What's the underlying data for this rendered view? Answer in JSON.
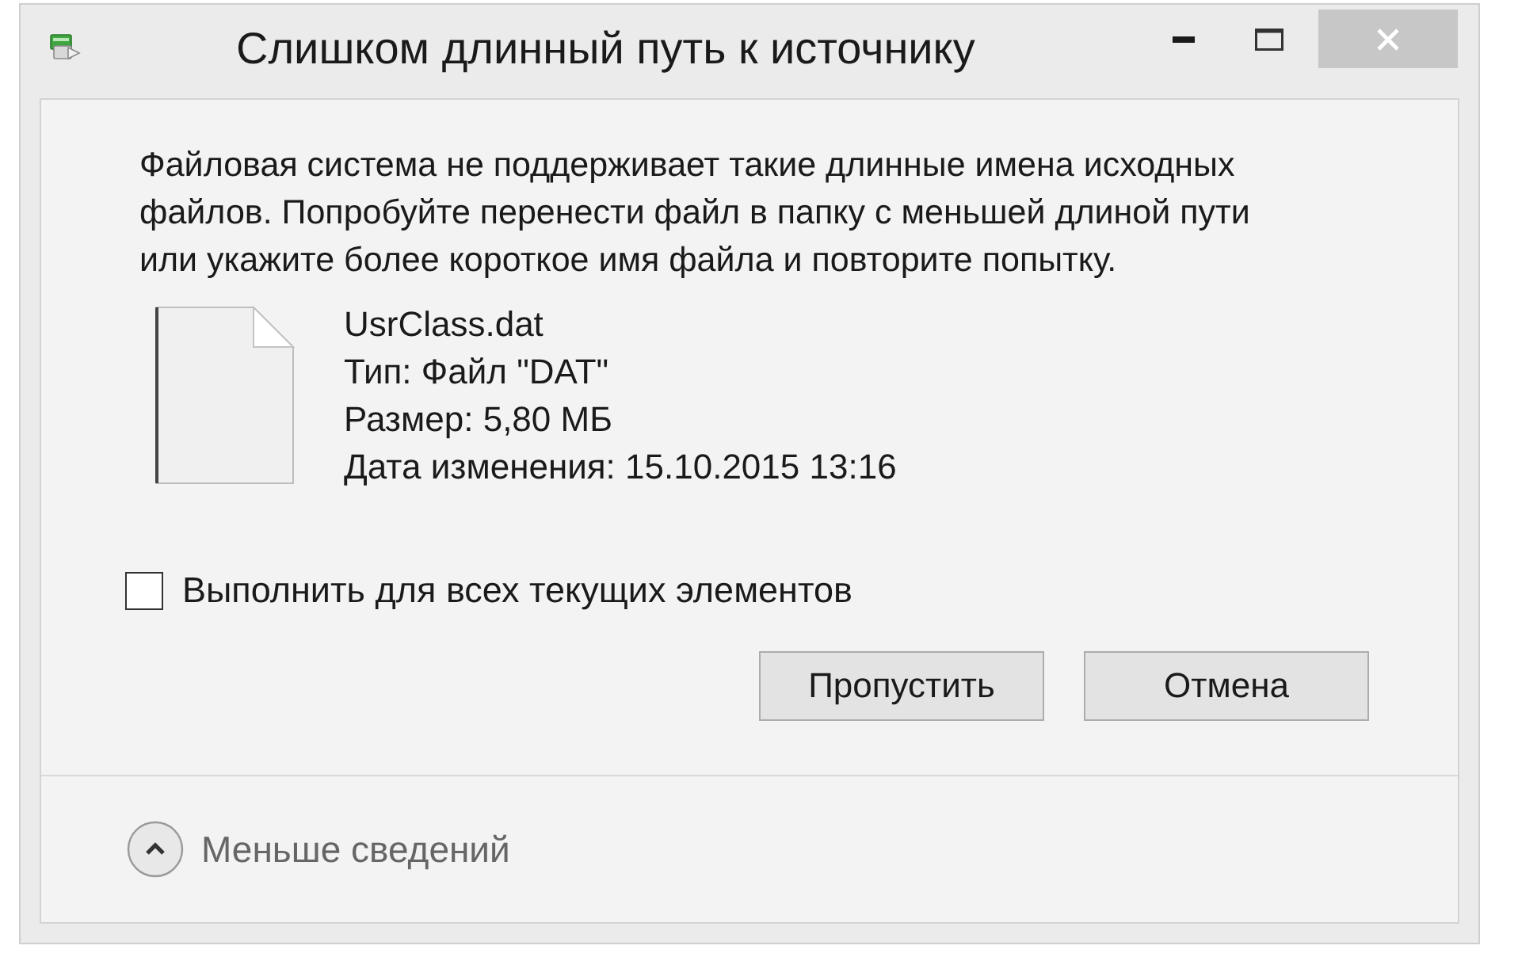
{
  "window": {
    "title": "Слишком длинный путь к источнику"
  },
  "message": "Файловая система не поддерживает такие длинные имена исходных файлов. Попробуйте перенести файл в папку с меньшей длиной пути или укажите более короткое имя файла и повторите попытку.",
  "file": {
    "name": "UsrClass.dat",
    "details": [
      "Тип: Файл \"DAT\"",
      "Размер: 5,80 МБ",
      "Дата изменения: 15.10.2015 13:16"
    ]
  },
  "apply_to_all": {
    "label": "Выполнить для всех текущих элементов",
    "checked": false
  },
  "buttons": [
    {
      "label": "Пропустить"
    },
    {
      "label": "Отмена"
    }
  ],
  "details_toggle": {
    "label": "Меньше сведений",
    "expanded": true
  }
}
